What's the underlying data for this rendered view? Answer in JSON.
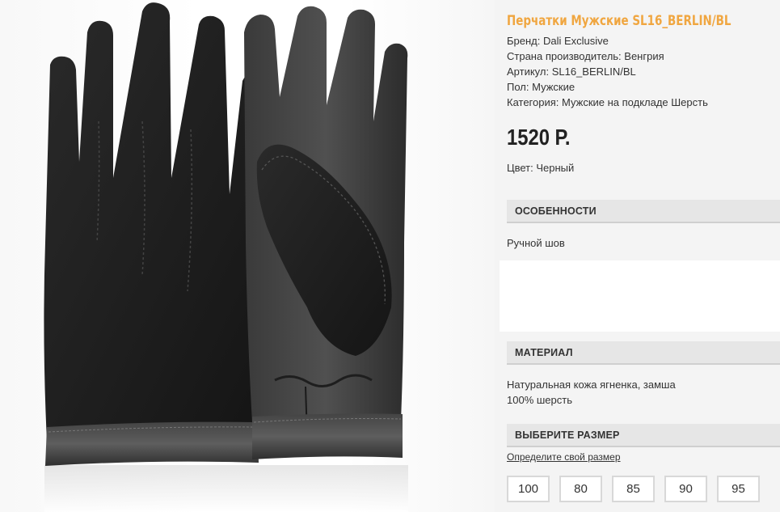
{
  "product": {
    "title": "Перчатки Мужские SL16_BERLIN/BL",
    "brand": "Бренд: Dali Exclusive",
    "country": "Страна производитель: Венгрия",
    "article": "Артикул: SL16_BERLIN/BL",
    "gender": "Пол: Мужские",
    "category": "Категория: Мужские на подкладе Шерсть",
    "price": "1520 Р.",
    "color": "Цвет: Черный"
  },
  "features": {
    "heading": "ОСОБЕННОСТИ",
    "text": "Ручной шов"
  },
  "material": {
    "heading": "МАТЕРИАЛ",
    "line1": "Натуральная кожа ягненка, замша",
    "line2": "100% шерсть"
  },
  "size": {
    "heading": "ВЫБЕРИТЕ РАЗМЕР",
    "link": "Определите свой размер",
    "options": [
      "100",
      "80",
      "85",
      "90",
      "95"
    ]
  },
  "colors": {
    "accent": "#f0a640",
    "panel": "#f4f4f4",
    "header_bg": "#e6e6e6"
  }
}
